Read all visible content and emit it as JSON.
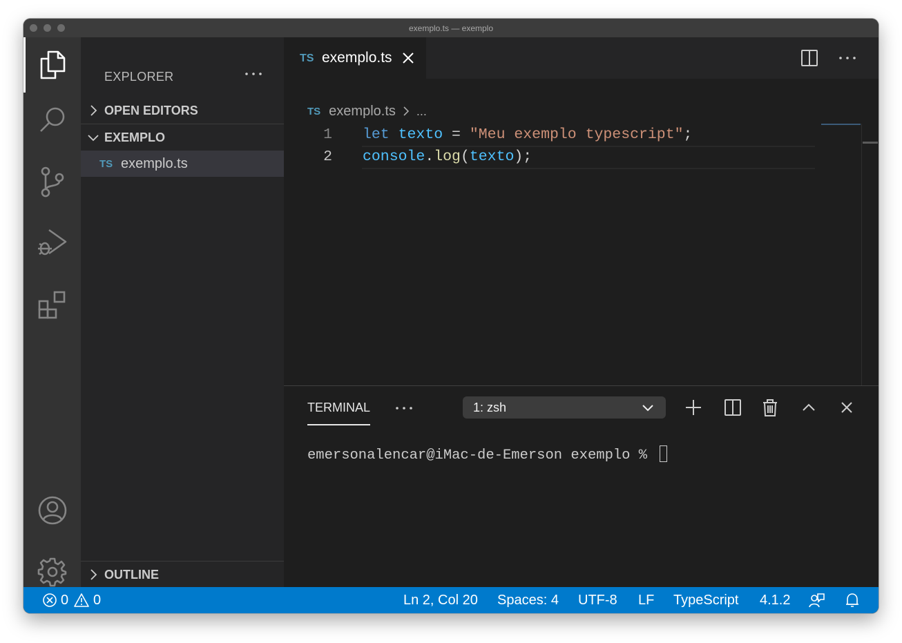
{
  "window": {
    "title": "exemplo.ts — exemplo"
  },
  "sidebar": {
    "title": "EXPLORER",
    "sections": {
      "open_editors": "OPEN EDITORS",
      "folder": "EXEMPLO",
      "outline": "OUTLINE"
    },
    "file": {
      "badge": "TS",
      "name": "exemplo.ts"
    }
  },
  "editor": {
    "tab": {
      "badge": "TS",
      "name": "exemplo.ts"
    },
    "breadcrumb": {
      "badge": "TS",
      "file": "exemplo.ts",
      "more": "..."
    },
    "lines": [
      {
        "num": "1",
        "tokens": [
          {
            "t": "let",
            "c": "#569cd6"
          },
          {
            "t": " ",
            "c": "#d4d4d4"
          },
          {
            "t": "texto",
            "c": "#4fc1ff"
          },
          {
            "t": " = ",
            "c": "#d4d4d4"
          },
          {
            "t": "\"Meu exemplo typescript\"",
            "c": "#ce9178"
          },
          {
            "t": ";",
            "c": "#d4d4d4"
          }
        ]
      },
      {
        "num": "2",
        "tokens": [
          {
            "t": "console",
            "c": "#4fc1ff"
          },
          {
            "t": ".",
            "c": "#d4d4d4"
          },
          {
            "t": "log",
            "c": "#dcdcaa"
          },
          {
            "t": "(",
            "c": "#d4d4d4"
          },
          {
            "t": "texto",
            "c": "#4fc1ff"
          },
          {
            "t": ");",
            "c": "#d4d4d4"
          }
        ]
      }
    ]
  },
  "panel": {
    "tab": "TERMINAL",
    "terminal_select": "1: zsh",
    "prompt": "emersonalencar@iMac-de-Emerson exemplo % "
  },
  "statusbar": {
    "errors": "0",
    "warnings": "0",
    "position": "Ln 2, Col 20",
    "spaces": "Spaces: 4",
    "encoding": "UTF-8",
    "eol": "LF",
    "language": "TypeScript",
    "version": "4.1.2"
  },
  "colors": {
    "accent": "#007acc",
    "ts_badge": "#519aba"
  }
}
